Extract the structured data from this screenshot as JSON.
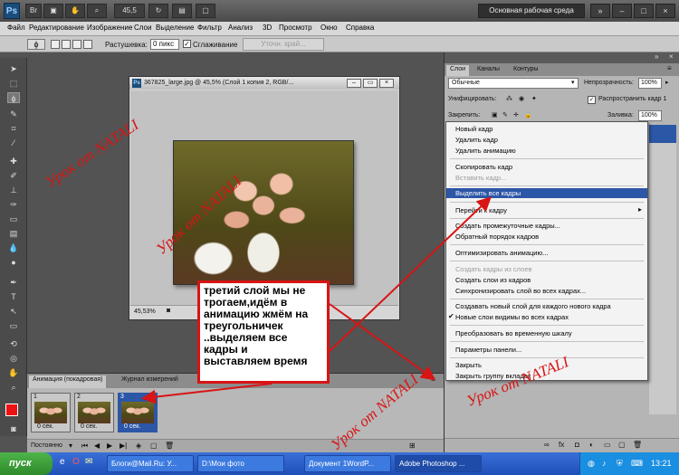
{
  "titlebar": {
    "app_logo": "Ps",
    "zoom": "45,5",
    "workspace": "Основная рабочая среда",
    "win_buttons": [
      "»",
      "–",
      "□",
      "×"
    ]
  },
  "menubar": [
    "Файл",
    "Редактирование",
    "Изображение",
    "Слои",
    "Выделение",
    "Фильтр",
    "Анализ",
    "3D",
    "Просмотр",
    "Окно",
    "Справка"
  ],
  "options": {
    "feather_label": "Растушевка:",
    "feather_value": "0 пикс",
    "antialias_label": "Сглаживание",
    "refine_button": "Уточн. край..."
  },
  "document": {
    "title": "367825_large.jpg @ 45,5% (Слой 1 копия 2, RGB/...",
    "zoom_status": "45,53%"
  },
  "panels": {
    "tabs": [
      "Слои",
      "Каналы",
      "Контуры"
    ],
    "blend_mode": "Обычные",
    "opacity_label": "Непрозрачность:",
    "opacity_value": "100%",
    "unify_label": "Унифицировать:",
    "propagate_label": "Распространить кадр 1",
    "lock_label": "Закрепить:",
    "fill_label": "Заливка:",
    "fill_value": "100%"
  },
  "context_menu": [
    {
      "label": "Новый кадр",
      "disabled": false,
      "sep_before": false
    },
    {
      "label": "Удалить кадр",
      "disabled": false,
      "sep_before": false
    },
    {
      "label": "Удалить анимацию",
      "disabled": false,
      "sep_before": false
    },
    {
      "label": "Скопировать кадр",
      "disabled": false,
      "sep_before": true
    },
    {
      "label": "Вставить кадр...",
      "disabled": true,
      "sep_before": false
    },
    {
      "label": "Выделить все кадры",
      "disabled": false,
      "sep_before": true,
      "highlighted": true
    },
    {
      "label": "Перейти к кадру",
      "disabled": false,
      "sep_before": true,
      "submenu": true
    },
    {
      "label": "Создать промежуточные кадры...",
      "disabled": false,
      "sep_before": true
    },
    {
      "label": "Обратный порядок кадров",
      "disabled": false,
      "sep_before": false
    },
    {
      "label": "Оптимизировать анимацию...",
      "disabled": false,
      "sep_before": true
    },
    {
      "label": "Создать кадры из слоев",
      "disabled": true,
      "sep_before": true
    },
    {
      "label": "Создать слои из кадров",
      "disabled": false,
      "sep_before": false
    },
    {
      "label": "Синхронизировать слой во всех кадрах...",
      "disabled": false,
      "sep_before": false
    },
    {
      "label": "Создавать новый слой для каждого нового кадра",
      "disabled": false,
      "sep_before": true
    },
    {
      "label": "Новые слои видимы во всех кадрах",
      "disabled": false,
      "sep_before": false,
      "checked": true
    },
    {
      "label": "Преобразовать во временную шкалу",
      "disabled": false,
      "sep_before": true
    },
    {
      "label": "Параметры панели...",
      "disabled": false,
      "sep_before": true
    },
    {
      "label": "Закрыть",
      "disabled": false,
      "sep_before": true
    },
    {
      "label": "Закрыть группу вкладок",
      "disabled": false,
      "sep_before": false
    }
  ],
  "animation": {
    "tab_active": "Анимация (покадровая)",
    "tab_other": "Журнал измерений",
    "loop": "Постоянно",
    "frames": [
      {
        "num": "1",
        "delay": "0 сек."
      },
      {
        "num": "2",
        "delay": "0 сек."
      },
      {
        "num": "3",
        "delay": "0 сек."
      }
    ]
  },
  "note": "третий слой мы не\nтрогаем,идём в\nанимацию жмём на\nтреугольничек\n..выделяем все\nкадры и\nвыставляем время",
  "watermark": "Урок от  NATALI",
  "taskbar": {
    "start": "пуск",
    "tasks": [
      "Блоги@Mail.Ru: У...",
      "D:\\Мои фото",
      "Документ 1WordP...",
      "Adobe Photoshop ..."
    ],
    "clock": "13:21"
  },
  "colors": {
    "accent": "#2c56a6",
    "annotation": "#d81414"
  }
}
